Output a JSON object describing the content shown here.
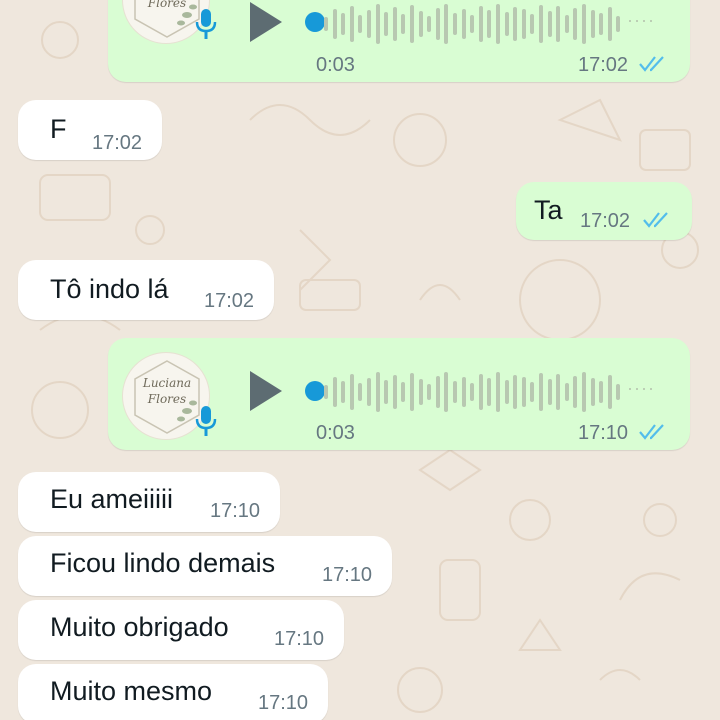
{
  "colors": {
    "wallpaper": "#efe7dd",
    "incoming_bubble": "#ffffff",
    "outgoing_bubble": "#d9fdd3",
    "read_ticks": "#53bdeb",
    "voice_accent": "#1799d8"
  },
  "voice_notes": [
    {
      "duration": "0:03",
      "time": "17:02",
      "status": "read",
      "avatar_text": "Luciana Flores",
      "icons": [
        "play-icon",
        "microphone-icon",
        "double-check-icon"
      ]
    },
    {
      "duration": "0:03",
      "time": "17:10",
      "status": "read",
      "avatar_text": "Luciana Flores",
      "icons": [
        "play-icon",
        "microphone-icon",
        "double-check-icon"
      ]
    }
  ],
  "messages": [
    {
      "text": "F",
      "time": "17:02",
      "direction": "incoming"
    },
    {
      "text": "Ta",
      "time": "17:02",
      "direction": "outgoing",
      "status": "read"
    },
    {
      "text": "Tô indo lá",
      "time": "17:02",
      "direction": "incoming"
    },
    {
      "text": "Eu ameiiiii",
      "time": "17:10",
      "direction": "incoming"
    },
    {
      "text": "Ficou lindo demais",
      "time": "17:10",
      "direction": "incoming"
    },
    {
      "text": "Muito obrigado",
      "time": "17:10",
      "direction": "incoming"
    },
    {
      "text": "Muito mesmo",
      "time": "17:10",
      "direction": "incoming"
    }
  ]
}
